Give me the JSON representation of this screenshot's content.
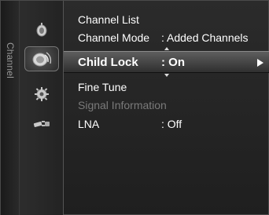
{
  "section_title": "Channel",
  "icons": [
    {
      "name": "antenna-icon"
    },
    {
      "name": "satellite-dish-icon"
    },
    {
      "name": "settings-gear-icon"
    },
    {
      "name": "plug-cable-icon"
    }
  ],
  "menu": {
    "items": [
      {
        "label": "Channel List",
        "value": ""
      },
      {
        "label": "Channel Mode",
        "value": ": Added Channels"
      },
      {
        "label": "Child Lock",
        "value": ": On"
      },
      {
        "label": "Fine Tune",
        "value": ""
      },
      {
        "label": "Signal Information",
        "value": ""
      },
      {
        "label": "LNA",
        "value": ": Off"
      }
    ]
  },
  "colors": {
    "background": "#242424",
    "highlight": "#5e5e5e",
    "text": "#ffffff",
    "disabled_text": "#7a7a7a"
  }
}
